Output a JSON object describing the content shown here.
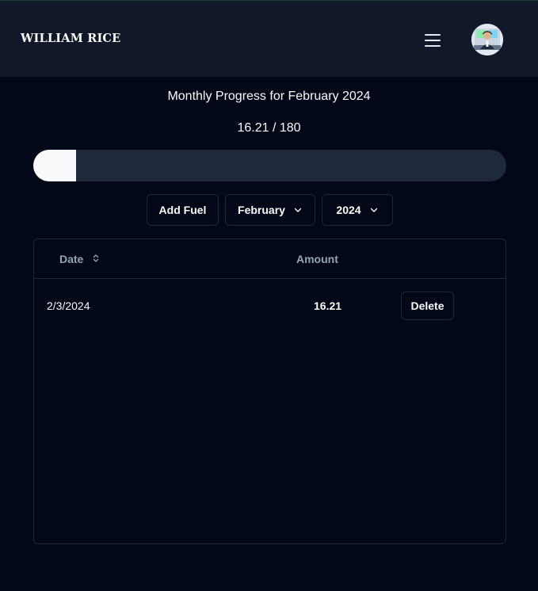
{
  "header": {
    "brand": "WILLIAM RICE",
    "menu_icon": "hamburger-menu-icon",
    "avatar_icon": "user-avatar"
  },
  "progress": {
    "title": "Monthly Progress for February 2024",
    "text": "16.21 / 180",
    "current": 16.21,
    "goal": 180,
    "fill_color": "#f8fafc",
    "track_color": "#1e293b"
  },
  "controls": {
    "add_fuel_label": "Add Fuel",
    "month_selected": "February",
    "year_selected": "2024",
    "dropdown_icon": "chevron-down-icon"
  },
  "table": {
    "columns": {
      "date": "Date",
      "amount": "Amount"
    },
    "sort_icon": "sort-icon",
    "rows": [
      {
        "date": "2/3/2024",
        "amount": "16.21",
        "action": "Delete"
      }
    ]
  },
  "colors": {
    "background": "#020817",
    "header_bg": "#111827",
    "border": "#1e293b",
    "muted_text": "#94a3b8"
  }
}
